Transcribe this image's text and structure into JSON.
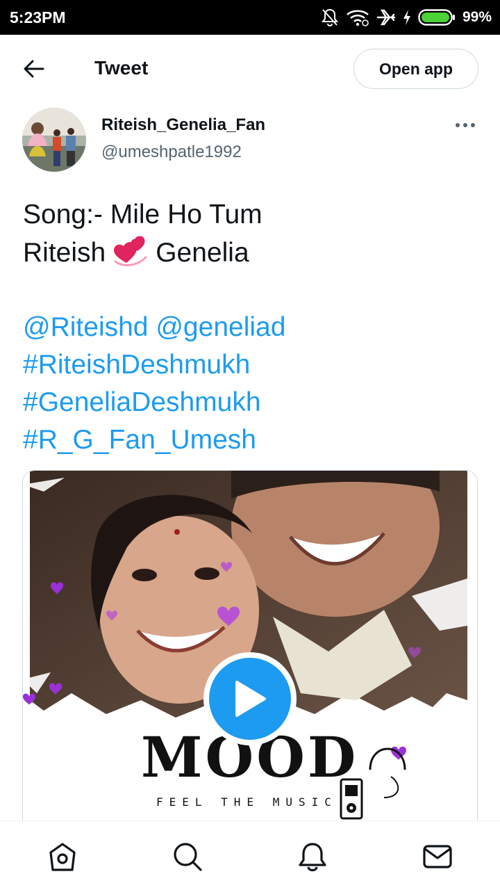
{
  "status_bar": {
    "time": "5:23PM",
    "battery_percent": "99%",
    "icons": [
      "bell-muted-icon",
      "wifi-icon",
      "airplane-icon",
      "charging-icon",
      "battery-icon"
    ]
  },
  "header": {
    "title": "Tweet",
    "open_app_label": "Open app",
    "back_icon": "arrow-left-icon",
    "more_icon": "more-horizontal-icon"
  },
  "author": {
    "display_name": "Riteish_Genelia_Fan",
    "handle": "@umeshpatle1992"
  },
  "tweet": {
    "line1": "Song:- Mile Ho Tum",
    "line2_before": "Riteish",
    "line2_emoji": "two-hearts-emoji",
    "line2_after": "Genelia",
    "mention1": "@Riteishd",
    "mention2": "@geneliad",
    "hashtag1": "#RiteishDeshmukh",
    "hashtag2": "#GeneliaDeshmukh",
    "hashtag3": "#R_G_Fan_Umesh"
  },
  "media": {
    "overlay_title": "MOOD",
    "overlay_subtitle": "FEEL THE MUSIC",
    "play_icon": "play-icon"
  },
  "bottom_nav": {
    "items": [
      "home-icon",
      "search-icon",
      "notifications-icon",
      "messages-icon"
    ]
  },
  "colors": {
    "accent": "#1d9bf0",
    "text": "#0f1419",
    "secondary": "#536471",
    "border": "#cfd9de",
    "heart": "#9b30d9"
  }
}
